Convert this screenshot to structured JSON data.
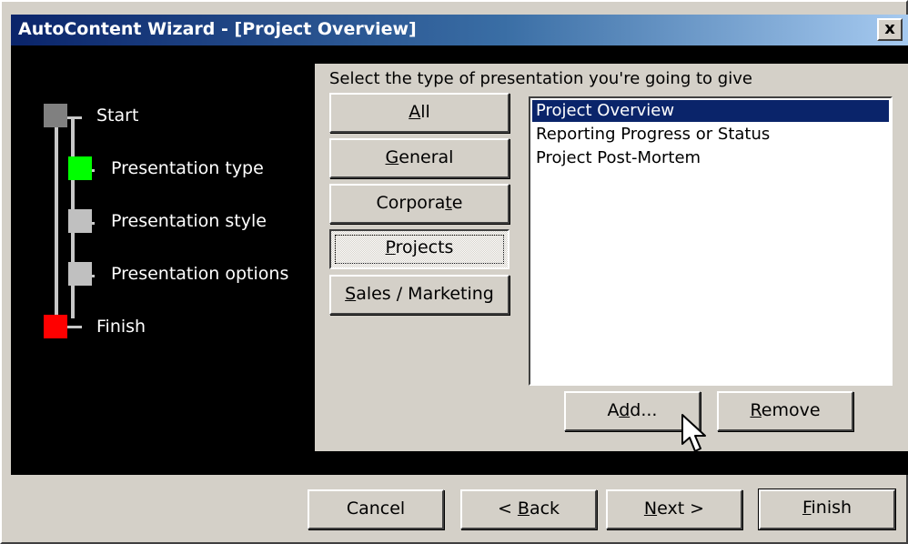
{
  "window": {
    "title": "AutoContent Wizard - [Project Overview]",
    "close_symbol": "x"
  },
  "steps": [
    {
      "label": "Start",
      "color": "#808080",
      "state": "done"
    },
    {
      "label": "Presentation type",
      "color": "#00ff00",
      "state": "current"
    },
    {
      "label": "Presentation style",
      "color": "#c0c0c0",
      "state": "pending"
    },
    {
      "label": "Presentation options",
      "color": "#c0c0c0",
      "state": "pending"
    },
    {
      "label": "Finish",
      "color": "#ff0000",
      "state": "end"
    }
  ],
  "main": {
    "instruction": "Select the type of presentation you're going to give",
    "categories": [
      {
        "pre": "",
        "key": "A",
        "post": "ll"
      },
      {
        "pre": "",
        "key": "G",
        "post": "eneral"
      },
      {
        "pre": "Corpora",
        "key": "t",
        "post": "e"
      },
      {
        "pre": "",
        "key": "P",
        "post": "rojects"
      },
      {
        "pre": "",
        "key": "S",
        "post": "ales / Marketing"
      }
    ],
    "selected_category": "Projects",
    "list_items": [
      "Project Overview",
      "Reporting Progress or Status",
      "Project Post-Mortem"
    ],
    "selected_item": "Project Overview",
    "add_button": {
      "pre": "A",
      "key": "d",
      "post": "d..."
    },
    "remove_button": {
      "pre": "",
      "key": "R",
      "post": "emove"
    }
  },
  "footer": {
    "cancel": {
      "pre": "Cancel",
      "key": "",
      "post": ""
    },
    "back": {
      "pre": "< ",
      "key": "B",
      "post": "ack"
    },
    "next": {
      "pre": "",
      "key": "N",
      "post": "ext >"
    },
    "finish": {
      "pre": "",
      "key": "F",
      "post": "inish"
    }
  },
  "colors": {
    "title_gradient_start": "#0a246a",
    "title_gradient_end": "#a6caf0",
    "selection": "#0a246a",
    "dialog_face": "#d4d0c8"
  },
  "icons": {
    "cursor": "mouse-pointer-icon"
  }
}
